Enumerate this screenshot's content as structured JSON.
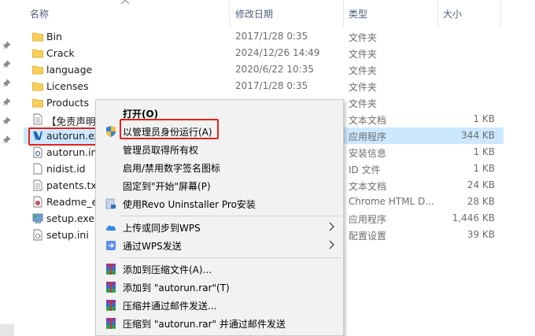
{
  "columns": {
    "name": "名称",
    "date": "修改日期",
    "type": "类型",
    "size": "大小"
  },
  "files": [
    {
      "name": "Bin",
      "date": "2017/1/28 0:35",
      "type": "文件夹",
      "size": "",
      "icon": "folder-icon"
    },
    {
      "name": "Crack",
      "date": "2024/12/26 14:49",
      "type": "文件夹",
      "size": "",
      "icon": "folder-icon"
    },
    {
      "name": "language",
      "date": "2020/6/22 10:35",
      "type": "文件夹",
      "size": "",
      "icon": "folder-icon"
    },
    {
      "name": "Licenses",
      "date": "2017/1/28 0:35",
      "type": "文件夹",
      "size": "",
      "icon": "folder-icon"
    },
    {
      "name": "Products",
      "date": "",
      "type": "文件夹",
      "size": "",
      "icon": "folder-icon"
    },
    {
      "name": "【免责声明",
      "date": "",
      "type": "文本文档",
      "size": "1 KB",
      "icon": "text-file-icon"
    },
    {
      "name": "autorun.ex",
      "date": "",
      "type": "应用程序",
      "size": "344 KB",
      "icon": "autorun-app-icon"
    },
    {
      "name": "autorun.inf",
      "date": "",
      "type": "安装信息",
      "size": "1 KB",
      "icon": "setup-info-file-icon"
    },
    {
      "name": "nidist.id",
      "date": "",
      "type": "ID 文件",
      "size": "1 KB",
      "icon": "blank-file-icon"
    },
    {
      "name": "patents.txt",
      "date": "",
      "type": "文本文档",
      "size": "24 KB",
      "icon": "text-file-icon"
    },
    {
      "name": "Readme_er",
      "date": "",
      "type": "Chrome HTML D...",
      "size": "28 KB",
      "icon": "chrome-html-file-icon"
    },
    {
      "name": "setup.exe",
      "date": "",
      "type": "应用程序",
      "size": "1,446 KB",
      "icon": "installer-app-icon"
    },
    {
      "name": "setup.ini",
      "date": "",
      "type": "配置设置",
      "size": "39 KB",
      "icon": "config-file-icon"
    }
  ],
  "context_menu": {
    "open": "打开(O)",
    "run_as_admin": "以管理员身份运行(A)",
    "take_ownership": "管理员取得所有权",
    "toggle_signature": "启用/禁用数字签名图标",
    "pin_start": "固定到\"开始\"屏幕(P)",
    "revo_uninstall": "使用Revo Uninstaller Pro安装",
    "upload_sync": "上传或同步到WPS",
    "send_wps": "通过WPS发送",
    "add_archive": "添加到压缩文件(A)...",
    "add_autorun_rar": "添加到 \"autorun.rar\"(T)",
    "compress_email": "压缩并通过邮件发送...",
    "compress_autorun_email": "压缩到 \"autorun.rar\" 并通过邮件发送"
  },
  "colors": {
    "selection": "#cce8ff",
    "highlight_box": "#e2231a",
    "folder": "#f8cf5a",
    "menu_bg": "#f2f2f2"
  }
}
